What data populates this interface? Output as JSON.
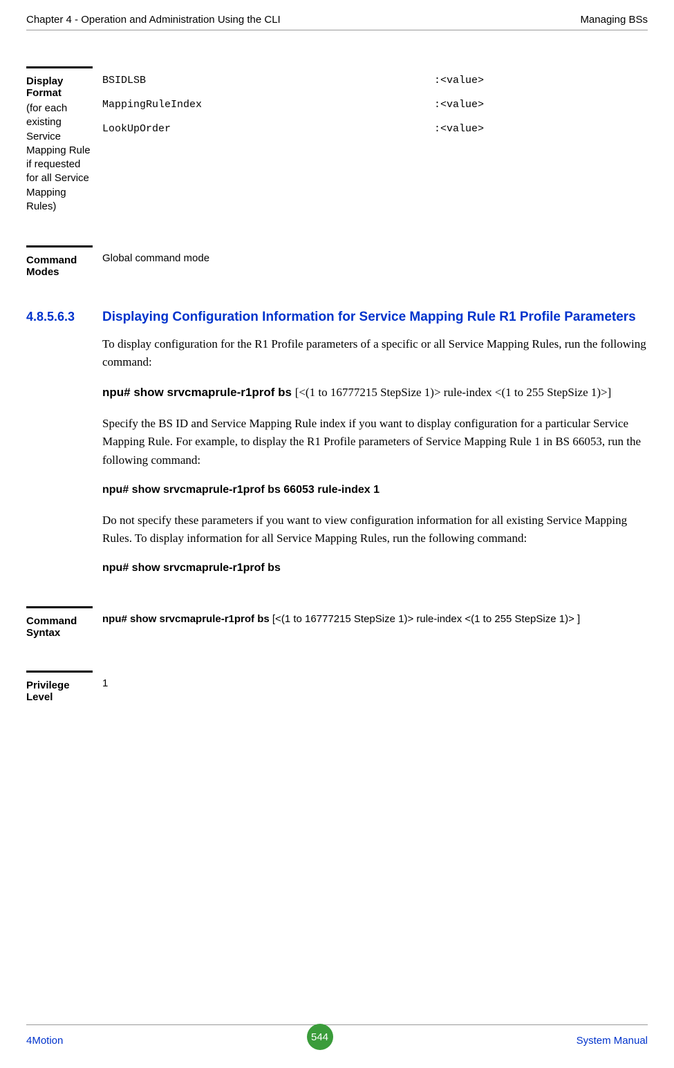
{
  "header": {
    "left": "Chapter 4 - Operation and Administration Using the CLI",
    "right": "Managing BSs"
  },
  "displayFormat": {
    "label": "Display Format",
    "note": "(for each existing Service Mapping Rule if requested for all Service Mapping Rules)",
    "rows": [
      {
        "key": "BSIDLSB",
        "val": ":<value>"
      },
      {
        "key": "MappingRuleIndex",
        "val": ":<value>"
      },
      {
        "key": "LookUpOrder",
        "val": ":<value>"
      }
    ]
  },
  "commandModes": {
    "label": "Command Modes",
    "value": "Global command mode"
  },
  "section": {
    "number": "4.8.5.6.3",
    "title": "Displaying Configuration Information for Service Mapping Rule R1 Profile Parameters",
    "para1": "To display configuration for the R1 Profile parameters of a specific or all Service Mapping Rules, run the following command:",
    "cmd1_bold": "npu# show srvcmaprule-r1prof bs ",
    "cmd1_rest": "[<(1 to 16777215 StepSize 1)> rule-index <(1 to 255 StepSize 1)>]",
    "para2": "Specify the BS ID and Service Mapping Rule index if you want to display configuration for a particular Service Mapping Rule. For example, to display the R1 Profile parameters of Service Mapping Rule 1 in BS 66053, run the following command:",
    "cmd2": "npu# show srvcmaprule-r1prof bs 66053 rule-index 1",
    "para3": "Do not specify these parameters if you want to view configuration information for all existing Service Mapping Rules. To display information for all Service Mapping Rules, run the following command:",
    "cmd3": "npu# show srvcmaprule-r1prof bs"
  },
  "commandSyntax": {
    "label": "Command Syntax",
    "bold": "npu# show srvcmaprule-r1prof bs ",
    "rest": "[<(1 to 16777215 StepSize 1)> rule-index <(1 to 255 StepSize 1)> ]"
  },
  "privilegeLevel": {
    "label": "Privilege Level",
    "value": "1"
  },
  "footer": {
    "left": "4Motion",
    "page": "544",
    "right": "System Manual"
  }
}
